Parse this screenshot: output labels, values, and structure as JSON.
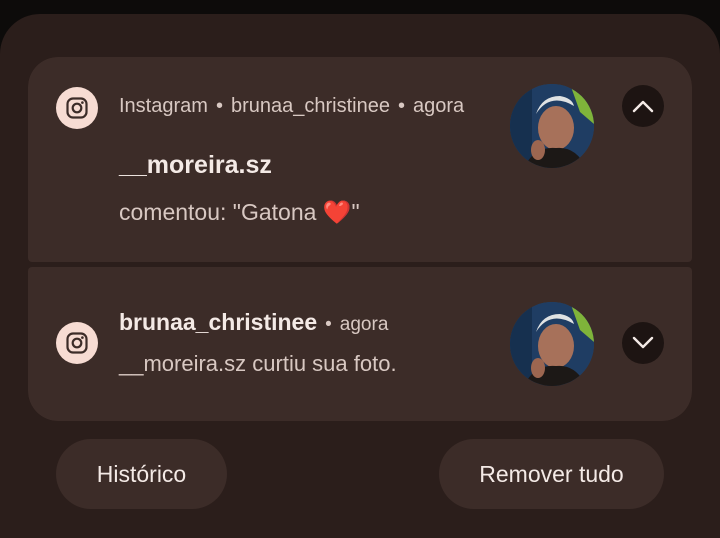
{
  "notifications": [
    {
      "app_name": "Instagram",
      "account": "brunaa_christinee",
      "time": "agora",
      "title": "__moreira.sz",
      "body": "comentou: \"Gatona ",
      "emoji": "❤️",
      "body_end": "\"",
      "toggle": "collapse"
    },
    {
      "title": "brunaa_christinee",
      "time": "agora",
      "body": "__moreira.sz curtiu sua foto.",
      "toggle": "expand"
    }
  ],
  "actions": {
    "history_label": "Histórico",
    "clear_all_label": "Remover tudo"
  },
  "colors": {
    "panel": "#2b1e1b",
    "card": "#3c2c28",
    "icon_bg": "#f7dcd3",
    "text_primary": "#f4eae6",
    "text_secondary": "#d8c8c2"
  }
}
